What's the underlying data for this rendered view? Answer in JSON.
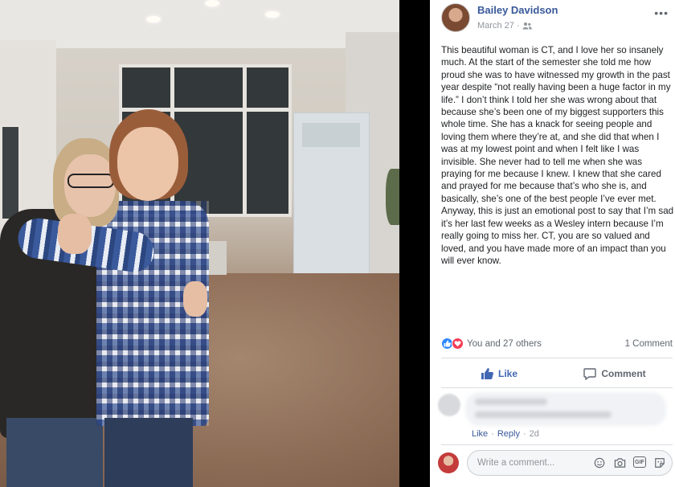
{
  "post": {
    "author": "Bailey Davidson",
    "date": "March 27",
    "body": "This beautiful woman is CT, and I love her so insanely much. At the start of the semester she told me how proud she was to have witnessed my growth in the past year despite “not really having been a huge factor in my life.” I don’t think I told her she was wrong about that because she’s been one of my biggest supporters this whole time. She has a knack for seeing people and loving them where they’re at, and she did that when I was at my lowest point and when I felt like I was invisible. She never had to tell me when she was praying for me because I knew. I knew that she cared and prayed for me because that’s who she is, and basically, she’s one of the best people I’ve ever met. Anyway, this is just an emotional post to say that I’m sad it’s her last few weeks as a Wesley intern because I’m really going to miss her. CT, you are so valued and loved, and you have made more of an impact than you will ever know.",
    "audience_icon": "friends-icon"
  },
  "stats": {
    "reactors": "You and 27 others",
    "comment_count": "1 Comment",
    "reaction_icons": [
      "like-icon",
      "love-icon"
    ]
  },
  "actions": {
    "like_label": "Like",
    "comment_label": "Comment",
    "like_color": "#4267b2"
  },
  "comment": {
    "like_label": "Like",
    "reply_label": "Reply",
    "separator": "·",
    "time": "2d"
  },
  "composer": {
    "placeholder": "Write a comment...",
    "icons": [
      "emoji-icon",
      "camera-icon",
      "gif-icon",
      "sticker-icon"
    ],
    "gif_label": "GIF"
  },
  "colors": {
    "link": "#385898",
    "secondary": "#90949c"
  }
}
